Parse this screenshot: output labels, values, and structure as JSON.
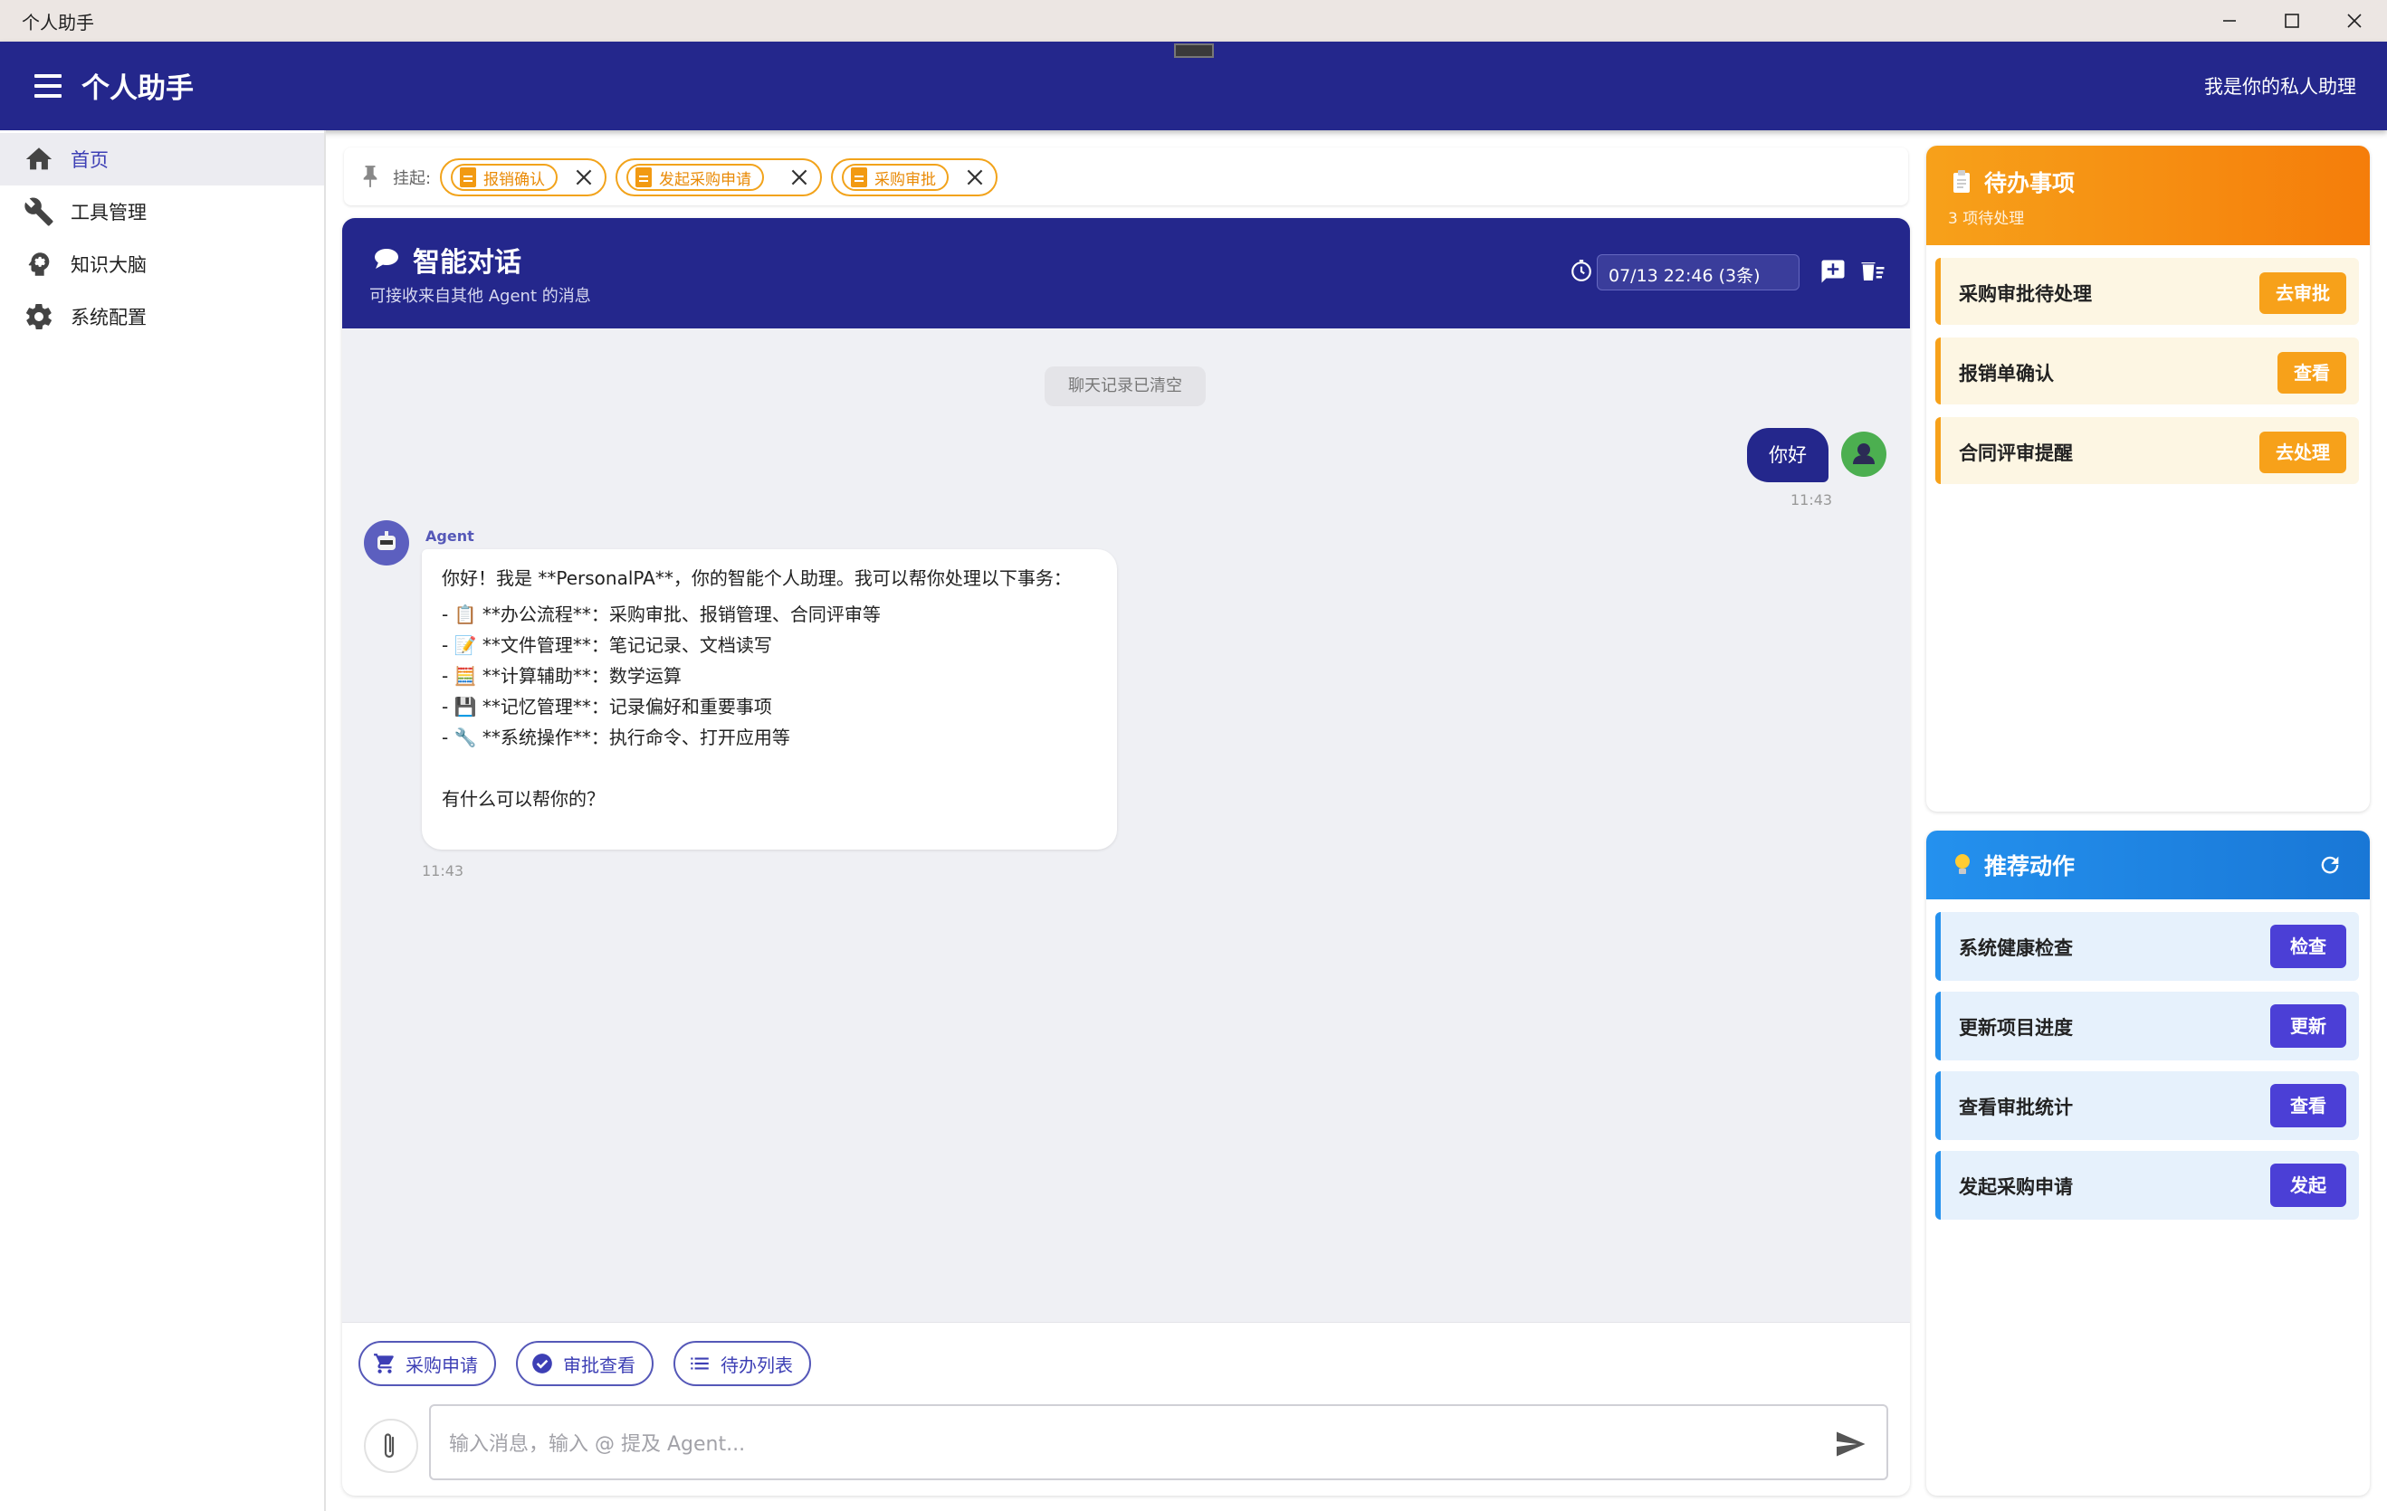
{
  "window": {
    "title": "个人助手",
    "controls": [
      "minimize",
      "maximize",
      "close"
    ]
  },
  "appbar": {
    "title": "个人助手",
    "subtitle": "我是你的私人助理"
  },
  "sidebar": {
    "items": [
      {
        "label": "首页",
        "icon": "home-icon",
        "active": true
      },
      {
        "label": "工具管理",
        "icon": "wrench-icon",
        "active": false
      },
      {
        "label": "知识大脑",
        "icon": "brain-icon",
        "active": false
      },
      {
        "label": "系统配置",
        "icon": "gear-icon",
        "active": false
      }
    ]
  },
  "pinbar": {
    "label": "挂起:",
    "chips": [
      {
        "label": "报销确认"
      },
      {
        "label": "发起采购申请"
      },
      {
        "label": "采购审批"
      }
    ]
  },
  "chat": {
    "title": "智能对话",
    "subtitle": "可接收来自其他 Agent 的消息",
    "session": "07/13 22:46 (3条)",
    "system_note": "聊天记录已清空",
    "user_message": {
      "text": "你好",
      "time": "11:43"
    },
    "agent_message": {
      "name": "Agent",
      "time": "11:43",
      "lines": [
        "你好！我是 **PersonalPA**，你的智能个人助理。我可以帮你处理以下事务：",
        "",
        "- 📋 **办公流程**：采购审批、报销管理、合同评审等",
        "- 📝 **文件管理**：笔记记录、文档读写",
        "- 🧮 **计算辅助**：数学运算",
        "- 💾 **记忆管理**：记录偏好和重要事项",
        "- 🔧 **系统操作**：执行命令、打开应用等",
        "",
        "有什么可以帮你的？"
      ]
    },
    "quick_actions": [
      {
        "label": "采购申请",
        "icon": "cart-icon"
      },
      {
        "label": "审批查看",
        "icon": "check-circle-icon"
      },
      {
        "label": "待办列表",
        "icon": "list-icon"
      }
    ],
    "input": {
      "placeholder": "输入消息，输入 @ 提及 Agent...",
      "value": ""
    }
  },
  "todo": {
    "title": "待办事项",
    "subtitle": "3 项待处理",
    "items": [
      {
        "label": "采购审批待处理",
        "action": "去审批"
      },
      {
        "label": "报销单确认",
        "action": "查看"
      },
      {
        "label": "合同评审提醒",
        "action": "去处理"
      }
    ]
  },
  "recommend": {
    "title": "推荐动作",
    "items": [
      {
        "label": "系统健康检查",
        "action": "检查"
      },
      {
        "label": "更新项目进度",
        "action": "更新"
      },
      {
        "label": "查看审批统计",
        "action": "查看"
      },
      {
        "label": "发起采购申请",
        "action": "发起"
      }
    ]
  },
  "colors": {
    "primary": "#24278c",
    "accent": "#4b3fd6",
    "todo_orange": "#f7a11a",
    "recommend_blue": "#2491ee"
  }
}
